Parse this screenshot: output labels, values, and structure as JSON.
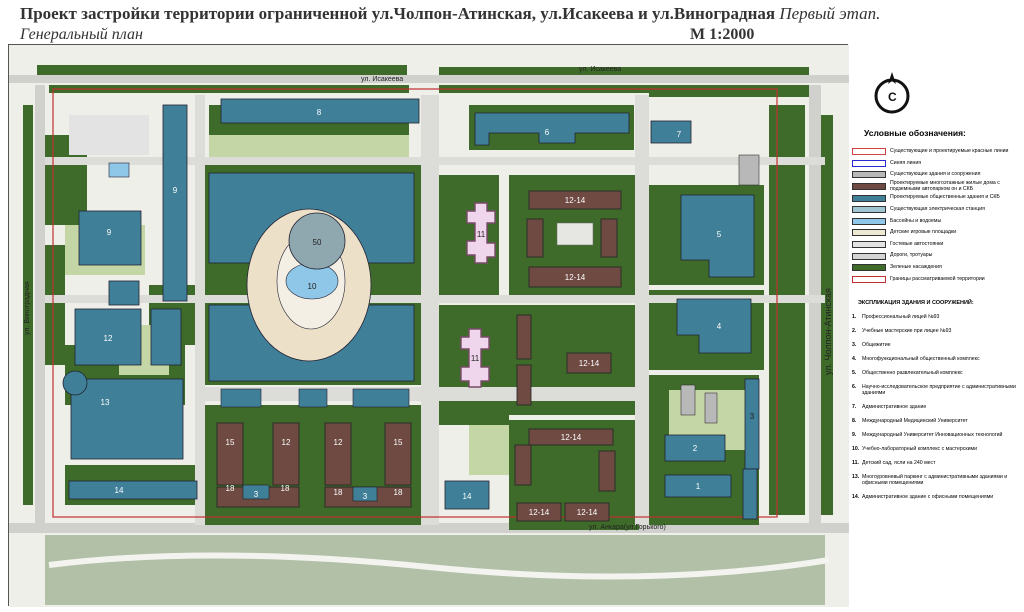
{
  "header": {
    "title": "Проект застройки территории ограниченной ул.Чолпон-Атинская, ул.Исакеева и ул.Виноградная",
    "stage": "Первый этап.",
    "subtitle": "Генеральный план",
    "scale": "М 1:2000"
  },
  "compass": {
    "label": "С"
  },
  "map": {
    "streets": {
      "top_left": "ул. Исакеева",
      "top_right": "ул. Исакеева",
      "left": "ул. Виноградная",
      "right": "ул. Чолпон-Атинская",
      "bottom": "ул. Анкара(ул.Горького)"
    },
    "building_labels": {
      "b8": "8",
      "b6": "6",
      "b7": "7",
      "b9a": "9",
      "b9b": "9",
      "b50": "50",
      "b10": "10",
      "b5": "5",
      "b4": "4",
      "b11a": "11",
      "b11b": "11",
      "b12": "12",
      "b13": "13",
      "b14a": "14",
      "b3": "3",
      "b2": "2",
      "b1": "1",
      "b14b": "14",
      "r1214a": "12-14",
      "r1214b": "12-14",
      "r1214c": "12-14",
      "r1214d": "12-14",
      "r1214e": "12-14",
      "r1214f": "12-14",
      "h15a": "15",
      "h12a": "12",
      "h18a": "18",
      "h3a": "3",
      "h18b": "18",
      "h12b": "12",
      "h15b": "15",
      "h18c": "18",
      "h3b": "3",
      "h18d": "18"
    }
  },
  "legend": {
    "title": "Условные обозначения:",
    "items": [
      {
        "label": "Существующие и проектируемые красные линии",
        "color": "#ffffff",
        "border": "#d04040"
      },
      {
        "label": "Синяя линия",
        "color": "#ffffff",
        "border": "#2a2ad0"
      },
      {
        "label": "Существующие здания и сооружения",
        "color": "#b8b8b8",
        "border": "#333333"
      },
      {
        "label": "Проектируемые многоэтажные жилые дома с подземными автопарком он и СКБ",
        "color": "#6e4a42",
        "border": "#333333"
      },
      {
        "label": "Проектируемые общественные здания и СКБ",
        "color": "#3f7f98",
        "border": "#333333"
      },
      {
        "label": "Существующая электрическая станция",
        "color": "#9fc4d2",
        "border": "#333333"
      },
      {
        "label": "Бассейны и водоемы",
        "color": "#8ec7e8",
        "border": "#333333"
      },
      {
        "label": "Детские игровые площадки",
        "color": "#ede8d2",
        "border": "#333333"
      },
      {
        "label": "Гостевые автостоянки",
        "color": "#e3e3e3",
        "border": "#333333"
      },
      {
        "label": "Дороги, тротуары",
        "color": "#d5d5d5",
        "border": "#333333"
      },
      {
        "label": "Зеленые насаждения",
        "color": "#3f6b2a",
        "border": "#333333"
      },
      {
        "label": "Границы рассматриваемой территории",
        "color": "#ffffff",
        "border": "#c03030"
      }
    ]
  },
  "explication": {
    "title": "ЭКСПЛИКАЦИЯ ЗДАНИЯ И СООРУЖЕНИЙ:",
    "items": [
      {
        "n": "1.",
        "text": "Профессиональный лицей №93"
      },
      {
        "n": "2.",
        "text": "Учебные мастерские при лицее №93"
      },
      {
        "n": "3.",
        "text": "Общежитие"
      },
      {
        "n": "4.",
        "text": "Многофункциональный общественный комплекс"
      },
      {
        "n": "5.",
        "text": "Общественно развлекательный комплекс"
      },
      {
        "n": "6.",
        "text": "Научно-исследовательское предприятие с административными зданиями"
      },
      {
        "n": "7.",
        "text": "Административное здание"
      },
      {
        "n": "8.",
        "text": "Международный Медицинский Университет"
      },
      {
        "n": "9.",
        "text": "Международный Университет Инновационных технологий"
      },
      {
        "n": "10.",
        "text": "Учебно-лабораторный комплекс с мастерскими"
      },
      {
        "n": "11.",
        "text": "Детский сад, ясли на 240 мест"
      },
      {
        "n": "13.",
        "text": "Многоуровневый паркинг с административными зданиями и офисными помещениями"
      },
      {
        "n": "14.",
        "text": "Административное здание с офисными помещениями"
      }
    ]
  },
  "colors": {
    "green": "#3f6b2a",
    "public": "#3f7f98",
    "residential": "#6e4a42",
    "road": "#d9d9d5",
    "light_green": "#c5d6a6",
    "red_line": "#d04040"
  }
}
